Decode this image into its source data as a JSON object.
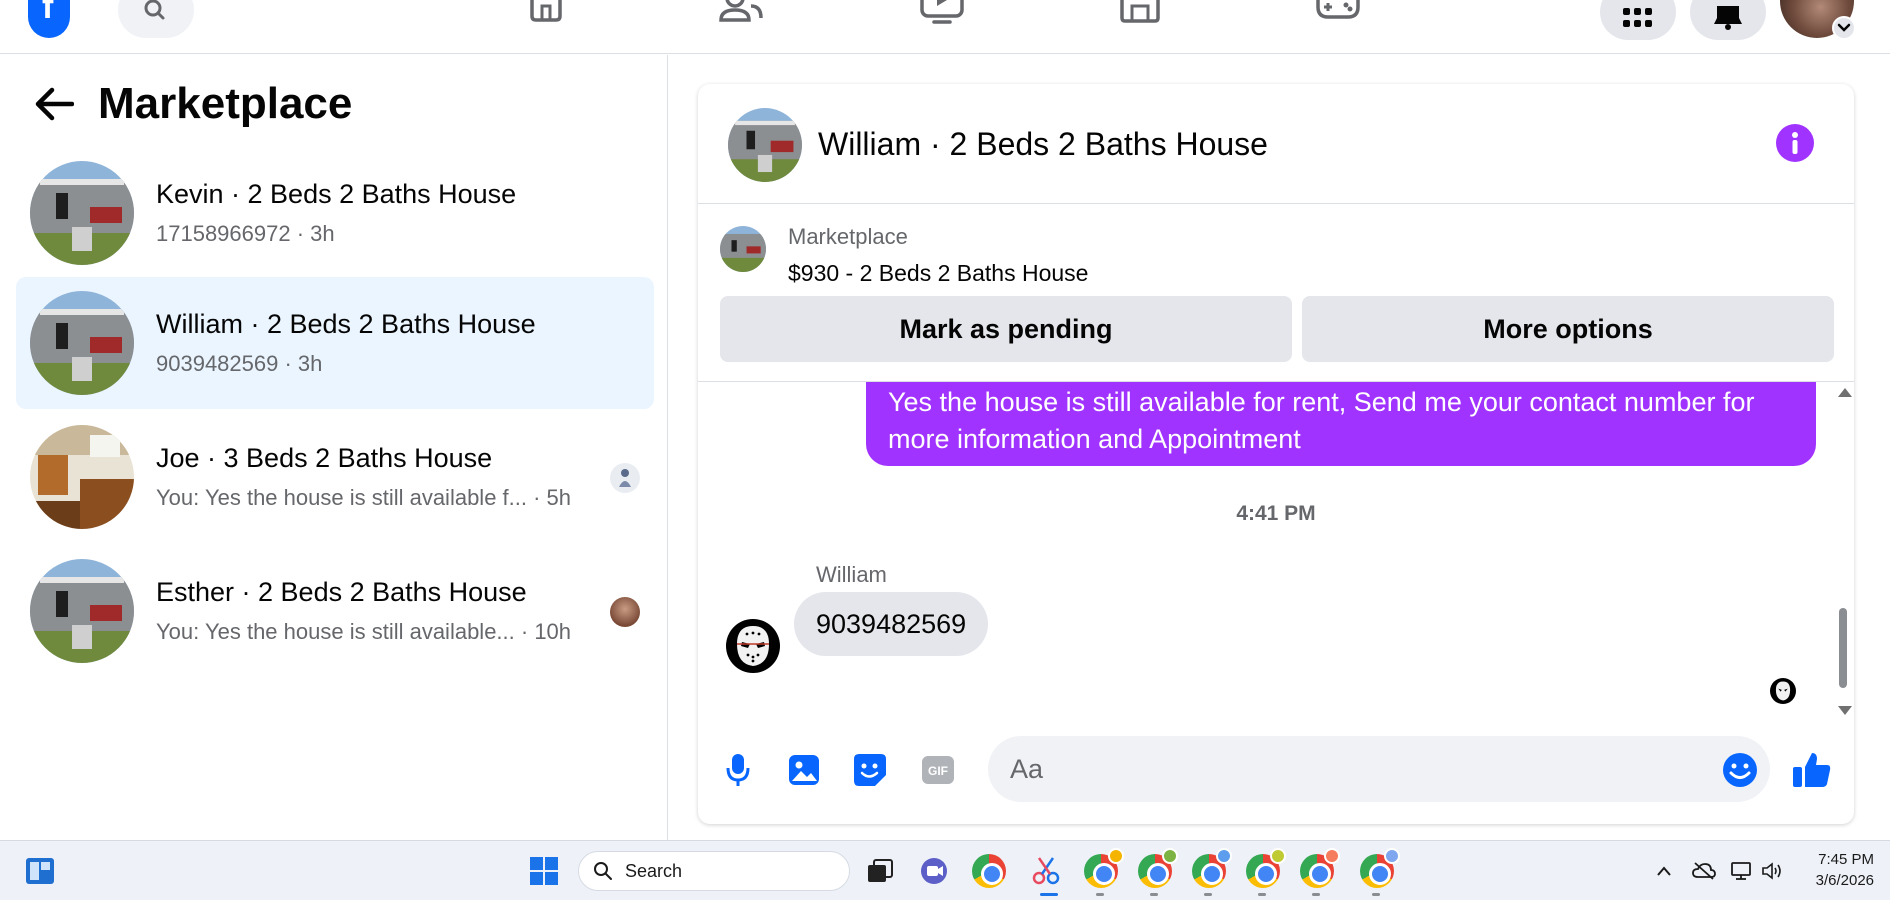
{
  "topbar": {
    "logo_letter": "f",
    "nav_icons": [
      "home-icon",
      "friends-icon",
      "watch-icon",
      "marketplace-icon",
      "gaming-icon"
    ],
    "right_icons": [
      "menu-grid-icon",
      "notifications-bell-icon",
      "profile-avatar"
    ]
  },
  "sidebar": {
    "title": "Marketplace",
    "conversations": [
      {
        "title": "Kevin · 2 Beds 2 Baths House",
        "subtitle": "17158966972 · 3h",
        "active": false
      },
      {
        "title": "William · 2 Beds 2 Baths House",
        "subtitle": "9039482569 · 3h",
        "active": true
      },
      {
        "title": "Joe · 3 Beds 2 Baths House",
        "subtitle": "You: Yes the house is still available f... · 5h",
        "active": false
      },
      {
        "title": "Esther · 2 Beds 2 Baths House",
        "subtitle": "You: Yes the house is still available... · 10h",
        "active": false
      }
    ]
  },
  "chat": {
    "title": "William · 2 Beds 2 Baths House",
    "listing": {
      "source": "Marketplace",
      "price_title": "$930 - 2 Beds 2 Baths House",
      "mark_pending": "Mark as pending",
      "more_options": "More options"
    },
    "messages": {
      "outgoing_text": "Yes the house is still available for rent, Send me your contact number for more information and Appointment",
      "timestamp": "4:41 PM",
      "sender": "William",
      "incoming_text": "9039482569"
    },
    "composer": {
      "placeholder": "Aa"
    }
  },
  "taskbar": {
    "search_label": "Search",
    "time": "7:45 PM",
    "date": "3/6/2026"
  },
  "colors": {
    "accent": "#a033ff",
    "facebook_blue": "#0866ff",
    "active_row": "#ebf5ff",
    "bubble_gray": "#e4e6eb"
  }
}
